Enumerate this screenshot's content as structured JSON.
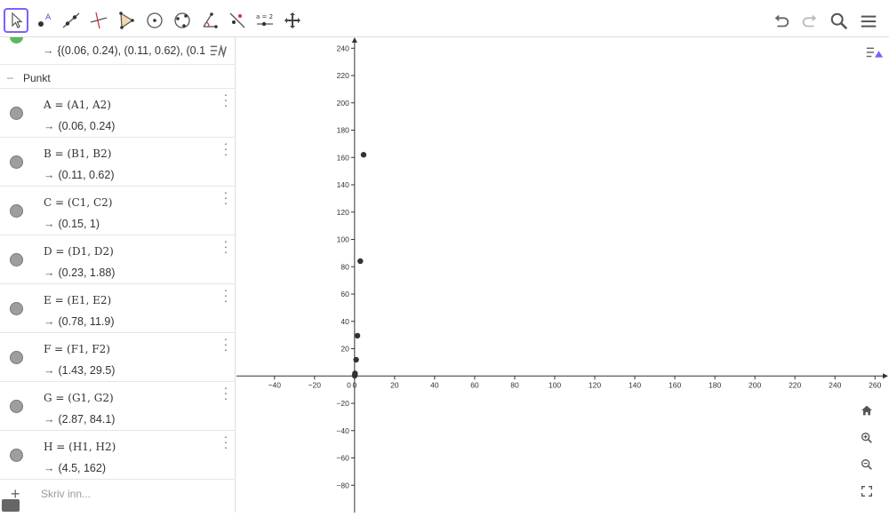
{
  "toolbar": {
    "tools": [
      "move-tool",
      "point-tool",
      "line-tool",
      "perpendicular-tool",
      "polygon-tool",
      "circle-center-tool",
      "circle-three-points-tool",
      "angle-tool",
      "reflect-tool",
      "slider-tool",
      "move-graphics-tool"
    ],
    "slider_label": "a = 2"
  },
  "algebra": {
    "top_sequence": "{(0.06, 0.24), (0.11, 0.62), (0.1",
    "section_label": "Punkt",
    "points": [
      {
        "def": "A = (A1, A2)",
        "val": "(0.06, 0.24)"
      },
      {
        "def": "B = (B1, B2)",
        "val": "(0.11, 0.62)"
      },
      {
        "def": "C = (C1, C2)",
        "val": "(0.15, 1)"
      },
      {
        "def": "D = (D1, D2)",
        "val": "(0.23, 1.88)"
      },
      {
        "def": "E = (E1, E2)",
        "val": "(0.78, 11.9)"
      },
      {
        "def": "F = (F1, F2)",
        "val": "(1.43, 29.5)"
      },
      {
        "def": "G = (G1, G2)",
        "val": "(2.87, 84.1)"
      },
      {
        "def": "H = (H1, H2)",
        "val": "(4.5, 162)"
      }
    ],
    "input_placeholder": "Skriv inn..."
  },
  "chart_data": {
    "type": "scatter",
    "x": [
      0.06,
      0.11,
      0.15,
      0.23,
      0.78,
      1.43,
      2.87,
      4.5
    ],
    "y": [
      0.24,
      0.62,
      1,
      1.88,
      11.9,
      29.5,
      84.1,
      162
    ],
    "xlim": [
      -59,
      267
    ],
    "ylim": [
      -100,
      248
    ],
    "xticks": [
      -40,
      -20,
      0,
      20,
      40,
      60,
      80,
      100,
      120,
      140,
      160,
      180,
      200,
      220,
      240,
      260
    ],
    "yticks": [
      -80,
      -60,
      -40,
      -20,
      20,
      40,
      60,
      80,
      100,
      120,
      140,
      160,
      180,
      200,
      220,
      240
    ],
    "origin_label": "0",
    "grid": false
  }
}
